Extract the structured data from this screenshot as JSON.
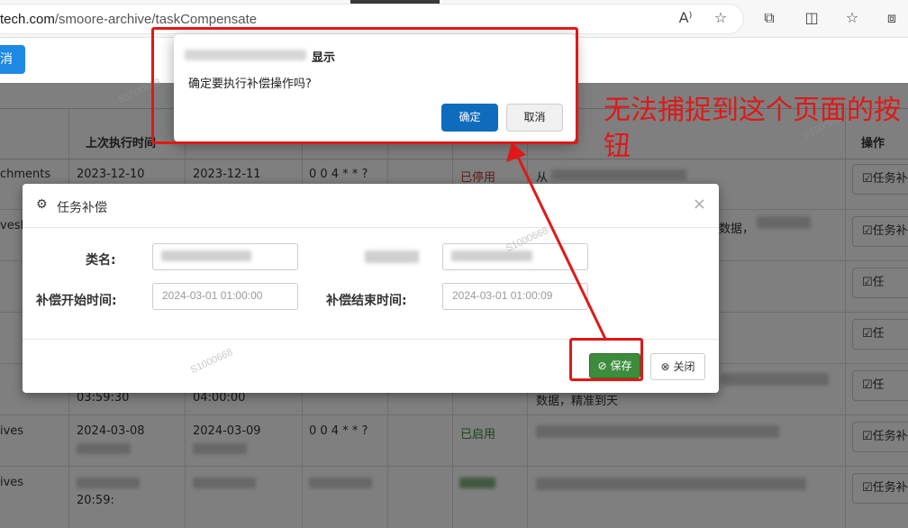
{
  "browser": {
    "url_host": "tech.com",
    "url_path": "/smoore-archive/taskCompensate",
    "icons": [
      "read-aloud-icon",
      "favorite-star-icon",
      "extensions-icon",
      "split-screen-icon",
      "favorites-icon",
      "collections-icon"
    ]
  },
  "header": {
    "top_button_label": "消"
  },
  "table": {
    "headers": {
      "last_exec": "上次执行时间",
      "action": "操作"
    },
    "rows": [
      {
        "name": "chments",
        "t1": "2023-12-10",
        "t2": "2023-12-11",
        "cron": "0 0 4 * * ?",
        "status": "已停用",
        "desc": "从"
      },
      {
        "name": "vesB",
        "desc_tail": "数据，"
      },
      {
        "t1": "03:59:30",
        "t2": "04:00:00",
        "desc": "数据，精准到天"
      },
      {
        "name": "ives",
        "t1": "2024-03-08",
        "t2": "2024-03-09",
        "cron": "0 0 4 * * ?",
        "status": "已启用"
      },
      {
        "name": "ives",
        "t1": "20:59:"
      }
    ],
    "op_labels": [
      "任务补偿",
      "任务补偿",
      "任务补偿",
      "任务补偿",
      "任务补偿",
      "任务补偿",
      "任务补偿"
    ],
    "op_visible": [
      "任务补",
      "任务补",
      "任",
      "任",
      "任",
      "任务补",
      "任务补"
    ]
  },
  "modal": {
    "title": "任务补偿",
    "fields": {
      "class_label": "类名:",
      "class_value": "",
      "start_label": "补偿开始时间:",
      "start_value": "2024-03-01 01:00:00",
      "end_label": "补偿结束时间:",
      "end_value": "2024-03-01 01:00:09"
    },
    "save_label": "保存",
    "close_label": "关闭"
  },
  "confirm": {
    "title_suffix": "显示",
    "message": "确定要执行补偿操作吗?",
    "ok_label": "确定",
    "cancel_label": "取消"
  },
  "annotation": {
    "text": "无法捕捉到这个页面的按钮",
    "color": "#e01818"
  },
  "watermark": "S1000668",
  "colors": {
    "primary": "#0f6cbd",
    "save_green": "#3c8c3c",
    "danger_red": "#c0392b",
    "enabled_green": "#2e8b2e"
  }
}
